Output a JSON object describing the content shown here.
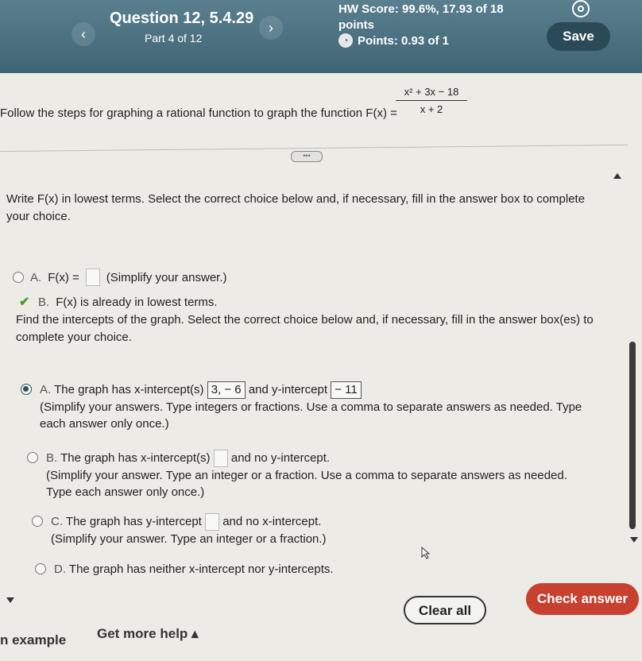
{
  "header": {
    "title": "Question 12, 5.4.29",
    "part": "Part 4 of 12",
    "hw_score": "HW Score: 99.6%, 17.93 of 18 points",
    "points": "Points: 0.93 of 1",
    "save_label": "Save",
    "prev_icon": "‹",
    "next_icon": "›"
  },
  "problem": {
    "text": "Follow the steps for graphing a rational function to graph the function F(x) =",
    "numerator": "x² + 3x − 18",
    "denominator": "x + 2"
  },
  "part1": {
    "instruction": "Write F(x) in lowest terms. Select the correct choice below and, if necessary, fill in the answer box to complete your choice.",
    "choice_a_letter": "A.",
    "choice_a_text": "F(x) =",
    "choice_a_hint": "(Simplify your answer.)",
    "choice_b_letter": "B.",
    "choice_b_text": "F(x) is already in lowest terms."
  },
  "part2": {
    "instruction": "Find the intercepts of the graph. Select the correct choice below and, if necessary, fill in the answer box(es) to complete your choice.",
    "choices": [
      {
        "letter": "A.",
        "text_pre": "The graph has x-intercept(s)",
        "box1": "3, − 6",
        "text_mid": "and y-intercept",
        "box2": "− 11",
        "hint": "(Simplify your answers. Type integers or fractions. Use a comma to separate answers as needed. Type each answer only once.)"
      },
      {
        "letter": "B.",
        "text_pre": "The graph has x-intercept(s)",
        "text_mid": "and no y-intercept.",
        "hint": "(Simplify your answer. Type an integer or a fraction. Use a comma to separate answers as needed. Type each answer only once.)"
      },
      {
        "letter": "C.",
        "text_pre": "The graph has y-intercept",
        "text_mid": "and no x-intercept.",
        "hint": "(Simplify your answer. Type an integer or a fraction.)"
      },
      {
        "letter": "D.",
        "text_pre": "The graph has neither x-intercept nor y-intercepts."
      }
    ]
  },
  "footer": {
    "example_label": "n example",
    "help_label": "Get more help ▴",
    "clear_label": "Clear all",
    "check_label": "Check answer"
  },
  "colors": {
    "header": "#4a7080",
    "save": "#2b4a58",
    "check_answer": "#c8402f"
  }
}
